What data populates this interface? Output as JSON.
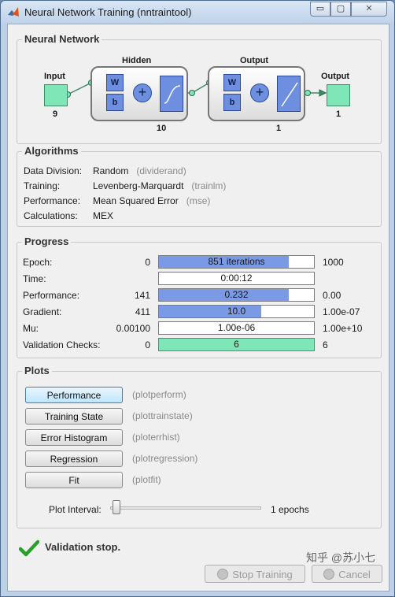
{
  "window": {
    "title": "Neural Network Training (nntraintool)",
    "min_glyph": "▭",
    "max_glyph": "▢",
    "close_glyph": "✕",
    "accent": "#bcd0e6"
  },
  "network": {
    "section_title": "Neural Network",
    "input_label": "Input",
    "input_size": "9",
    "hidden_label": "Hidden",
    "hidden_size": "10",
    "output_layer_label": "Output",
    "output_layer_size": "1",
    "output_label": "Output",
    "output_size": "1",
    "weight_symbol": "W",
    "bias_symbol": "b",
    "sum_symbol": "+"
  },
  "algorithms": {
    "section_title": "Algorithms",
    "rows": [
      {
        "key": "Data Division:",
        "value": "Random",
        "fn": "(dividerand)"
      },
      {
        "key": "Training:",
        "value": "Levenberg-Marquardt",
        "fn": "(trainlm)"
      },
      {
        "key": "Performance:",
        "value": "Mean Squared Error",
        "fn": "(mse)"
      },
      {
        "key": "Calculations:",
        "value": "MEX",
        "fn": ""
      }
    ]
  },
  "progress": {
    "section_title": "Progress",
    "rows": [
      {
        "label": "Epoch:",
        "min": "0",
        "text": "851 iterations",
        "max": "1000",
        "fraction": 0.84,
        "color": "blue"
      },
      {
        "label": "Time:",
        "min": "",
        "text": "0:00:12",
        "max": "",
        "fraction": 0,
        "color": "blue"
      },
      {
        "label": "Performance:",
        "min": "141",
        "text": "0.232",
        "max": "0.00",
        "fraction": 0.84,
        "color": "blue"
      },
      {
        "label": "Gradient:",
        "min": "411",
        "text": "10.0",
        "max": "1.00e-07",
        "fraction": 0.66,
        "color": "blue"
      },
      {
        "label": "Mu:",
        "min": "0.00100",
        "text": "1.00e-06",
        "max": "1.00e+10",
        "fraction": 0,
        "color": "blue"
      },
      {
        "label": "Validation Checks:",
        "min": "0",
        "text": "6",
        "max": "6",
        "fraction": 1.0,
        "color": "green"
      }
    ]
  },
  "plots": {
    "section_title": "Plots",
    "buttons": [
      {
        "label": "Performance",
        "fn": "(plotperform)"
      },
      {
        "label": "Training State",
        "fn": "(plottrainstate)"
      },
      {
        "label": "Error Histogram",
        "fn": "(ploterrhist)"
      },
      {
        "label": "Regression",
        "fn": "(plotregression)"
      },
      {
        "label": "Fit",
        "fn": "(plotfit)"
      }
    ],
    "interval_label": "Plot Interval:",
    "interval_value": "1 epochs"
  },
  "status": {
    "text": "Validation stop.",
    "icon": "check-icon",
    "icon_color": "#2aa02a"
  },
  "footer": {
    "stop_label": "Stop Training",
    "cancel_label": "Cancel"
  },
  "watermark": "知乎 @苏小七"
}
